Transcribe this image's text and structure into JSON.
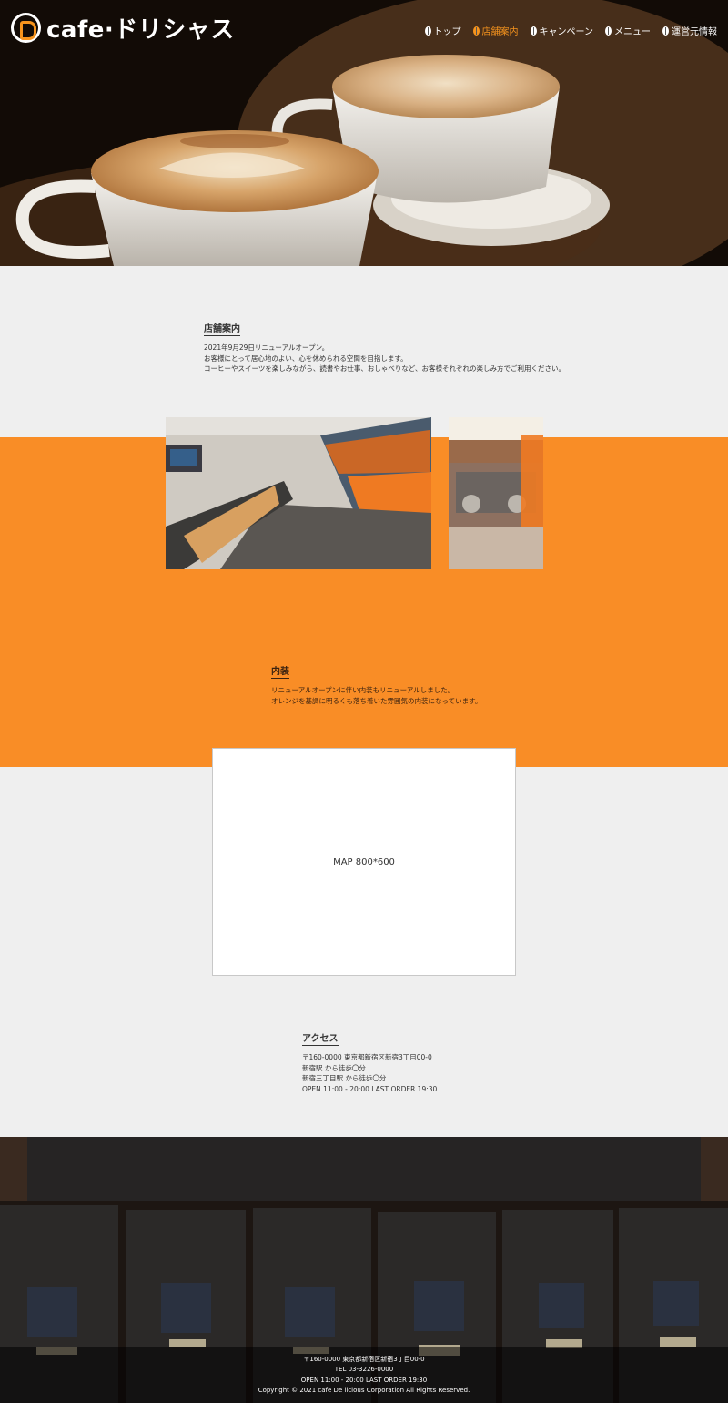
{
  "brand": {
    "logo_text": "cafe·ドリシャス"
  },
  "nav": {
    "items": [
      {
        "label": "トップ",
        "active": false
      },
      {
        "label": "店舗案内",
        "active": true
      },
      {
        "label": "キャンペーン",
        "active": false
      },
      {
        "label": "メニュー",
        "active": false
      },
      {
        "label": "運営元情報",
        "active": false
      }
    ]
  },
  "info": {
    "title": "店舗案内",
    "lines": [
      "2021年9月29日リニューアルオープン。",
      "お客様にとって居心地のよい、心を休められる空間を目指します。",
      "コーヒーやスイーツを楽しみながら、読書やお仕事、おしゃべりなど、お客様それぞれの楽しみ方でご利用ください。"
    ]
  },
  "interior": {
    "title": "内装",
    "lines": [
      "リニューアルオープンに伴い内装もリニューアルしました。",
      "オレンジを基調に明るくも落ち着いた雰囲気の内装になっています。"
    ]
  },
  "map": {
    "label": "MAP 800*600"
  },
  "access": {
    "title": "アクセス",
    "lines": [
      "〒160-0000 東京都新宿区新宿3丁目00-0",
      "新宿駅 から徒歩〇分",
      "新宿三丁目駅 から徒歩〇分",
      "OPEN 11:00 - 20:00 LAST ORDER 19:30"
    ]
  },
  "footer": {
    "lines": [
      "〒160-0000 東京都新宿区新宿3丁目00-0",
      "TEL 03-3226-0000",
      "OPEN 11:00 - 20:00 LAST ORDER 19:30",
      "Copyright © 2021 cafe De licious Corporation All Rights Reserved."
    ]
  },
  "colors": {
    "accent": "#f98d26",
    "bg": "#efefef",
    "text": "#333333"
  }
}
